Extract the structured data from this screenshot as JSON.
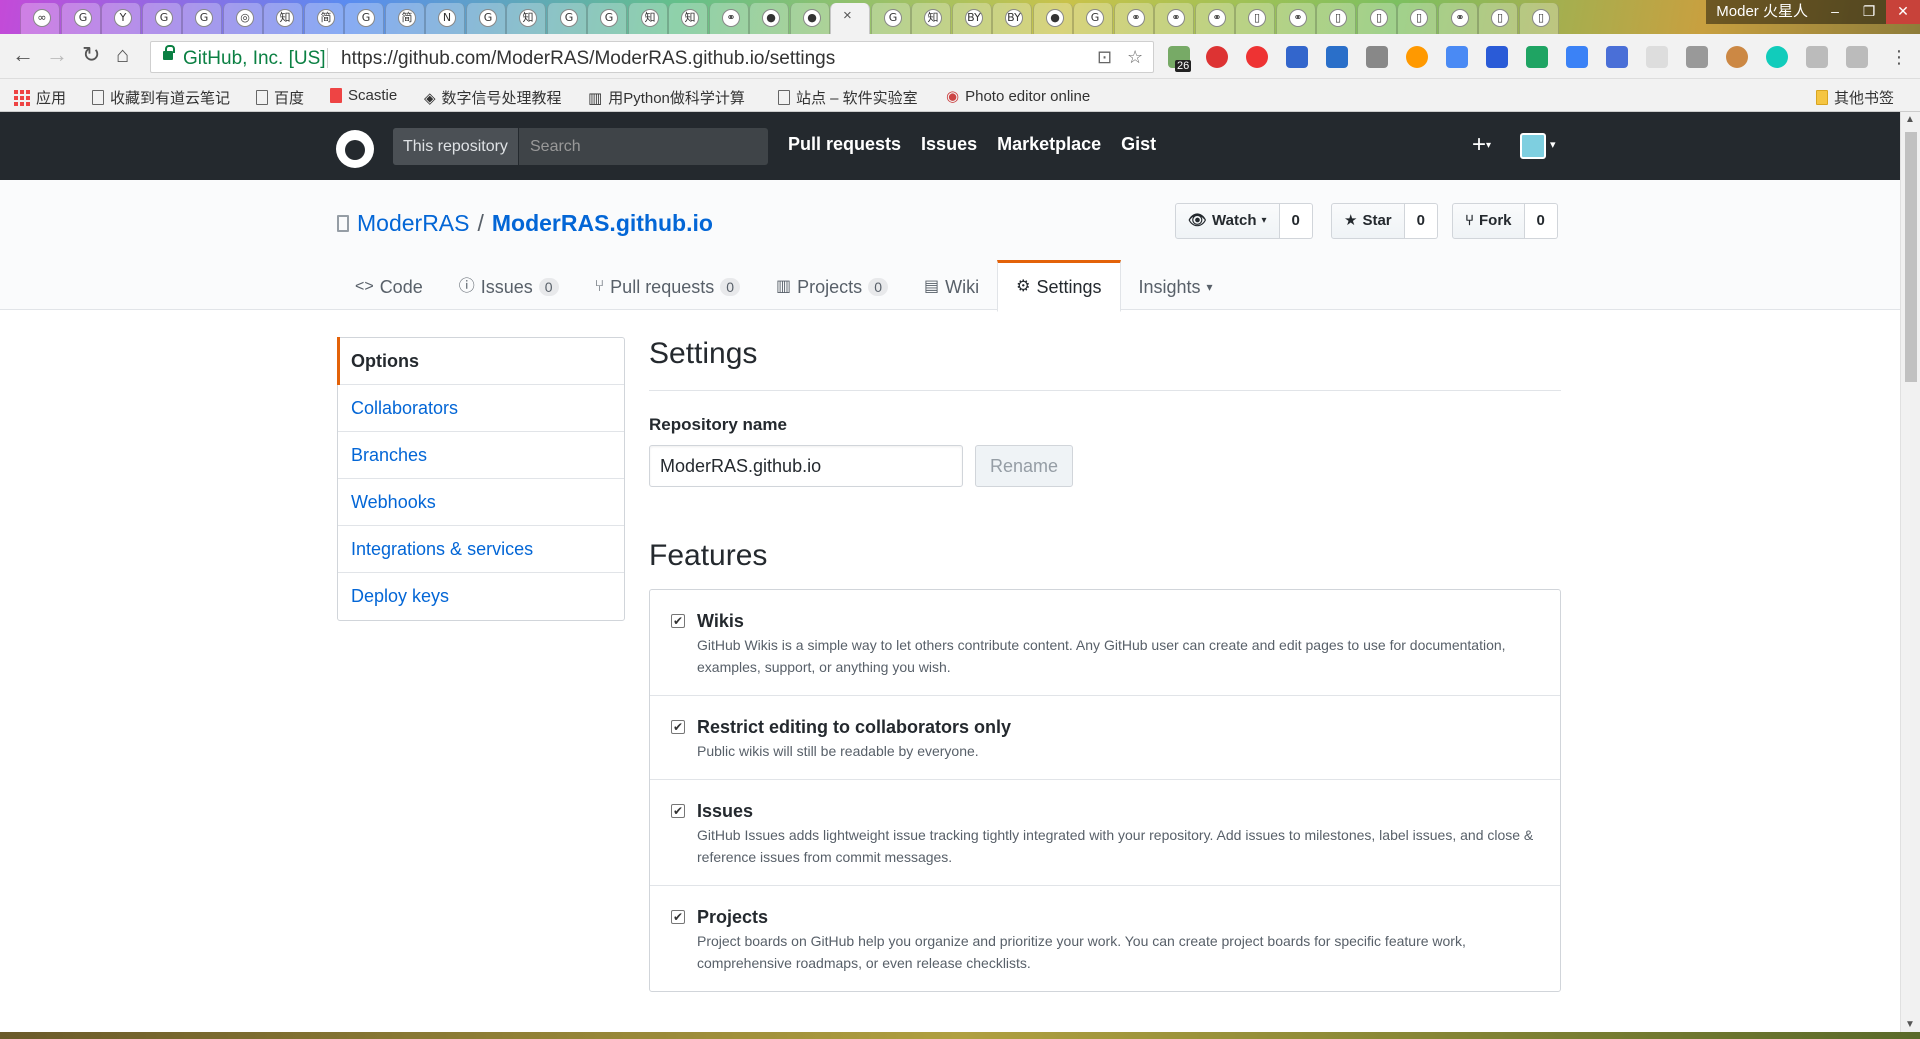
{
  "browser": {
    "window_profile": "Moder",
    "profile_name": "火星人",
    "active_tab_close": "×",
    "tabs": [
      {
        "icon": "infinity-icon",
        "glyph": "∞"
      },
      {
        "icon": "google-icon",
        "glyph": "G"
      },
      {
        "icon": "filter-icon",
        "glyph": "Y"
      },
      {
        "icon": "google-icon",
        "glyph": "G"
      },
      {
        "icon": "google-icon",
        "glyph": "G"
      },
      {
        "icon": "circle-icon",
        "glyph": "◎"
      },
      {
        "icon": "zhihu-icon",
        "glyph": "知"
      },
      {
        "icon": "jianshu-icon",
        "glyph": "简"
      },
      {
        "icon": "google-icon",
        "glyph": "G"
      },
      {
        "icon": "jianshu-icon",
        "glyph": "简"
      },
      {
        "icon": "n-icon",
        "glyph": "N"
      },
      {
        "icon": "google-icon",
        "glyph": "G"
      },
      {
        "icon": "zhihu-icon",
        "glyph": "知"
      },
      {
        "icon": "google-icon",
        "glyph": "G"
      },
      {
        "icon": "google-icon",
        "glyph": "G"
      },
      {
        "icon": "zhihu-icon",
        "glyph": "知"
      },
      {
        "icon": "zhihu-icon",
        "glyph": "知"
      },
      {
        "icon": "link-icon",
        "glyph": "⚭"
      },
      {
        "icon": "github-icon",
        "glyph": "●"
      },
      {
        "icon": "github-icon",
        "glyph": "●"
      },
      {
        "icon": "active",
        "glyph": ""
      },
      {
        "icon": "google-icon",
        "glyph": "G"
      },
      {
        "icon": "zhihu-icon",
        "glyph": "知"
      },
      {
        "icon": "by-icon",
        "glyph": "BY"
      },
      {
        "icon": "by-icon",
        "glyph": "BY"
      },
      {
        "icon": "github-icon",
        "glyph": "●"
      },
      {
        "icon": "google-icon",
        "glyph": "G"
      },
      {
        "icon": "link-icon",
        "glyph": "⚭"
      },
      {
        "icon": "link-icon",
        "glyph": "⚭"
      },
      {
        "icon": "link-icon",
        "glyph": "⚭"
      },
      {
        "icon": "page-icon",
        "glyph": "▯"
      },
      {
        "icon": "link-icon",
        "glyph": "⚭"
      },
      {
        "icon": "page-icon",
        "glyph": "▯"
      },
      {
        "icon": "page-icon",
        "glyph": "▯"
      },
      {
        "icon": "page-icon",
        "glyph": "▯"
      },
      {
        "icon": "link-icon",
        "glyph": "⚭"
      },
      {
        "icon": "page-icon",
        "glyph": "▯"
      },
      {
        "icon": "page-icon",
        "glyph": "▯"
      }
    ],
    "security_label": "GitHub, Inc. [US]",
    "url": "https://github.com/ModerRAS/ModerRAS.github.io/settings",
    "ext_badge": "26",
    "bookmarks": [
      {
        "label": "应用",
        "icon": "apps-icon"
      },
      {
        "label": "收藏到有道云笔记",
        "icon": "page-icon"
      },
      {
        "label": "百度",
        "icon": "page-icon"
      },
      {
        "label": "Scastie",
        "icon": "scastie-icon"
      },
      {
        "label": "数字信号处理教程",
        "icon": "diamond-icon"
      },
      {
        "label": "用Python做科学计算",
        "icon": "book-icon"
      },
      {
        "label": "站点 – 软件实验室",
        "icon": "page-icon"
      },
      {
        "label": "Photo editor online",
        "icon": "photo-icon"
      }
    ],
    "other_bookmarks": "其他书签"
  },
  "header": {
    "search_scope": "This repository",
    "search_placeholder": "Search",
    "nav": [
      "Pull requests",
      "Issues",
      "Marketplace",
      "Gist"
    ],
    "plus": "+"
  },
  "repo": {
    "owner": "ModerRAS",
    "separator": "/",
    "name": "ModerRAS.github.io",
    "watch_label": "Watch",
    "watch_count": "0",
    "star_label": "Star",
    "star_count": "0",
    "fork_label": "Fork",
    "fork_count": "0",
    "tabs": [
      {
        "label": "Code",
        "icon": "code-icon",
        "glyph": "<>",
        "counter": null
      },
      {
        "label": "Issues",
        "icon": "issue-icon",
        "glyph": "ⓘ",
        "counter": "0"
      },
      {
        "label": "Pull requests",
        "icon": "pull-request-icon",
        "glyph": "⑂",
        "counter": "0"
      },
      {
        "label": "Projects",
        "icon": "project-icon",
        "glyph": "▥",
        "counter": "0"
      },
      {
        "label": "Wiki",
        "icon": "book-icon",
        "glyph": "▤",
        "counter": null
      },
      {
        "label": "Settings",
        "icon": "gear-icon",
        "glyph": "⚙",
        "counter": null,
        "selected": true
      },
      {
        "label": "Insights",
        "icon": "caret-down-icon",
        "glyph": "▾",
        "counter": null,
        "dropdown": true
      }
    ]
  },
  "sidebar": {
    "items": [
      "Options",
      "Collaborators",
      "Branches",
      "Webhooks",
      "Integrations & services",
      "Deploy keys"
    ]
  },
  "settings": {
    "title": "Settings",
    "repo_name_label": "Repository name",
    "repo_name_value": "ModerRAS.github.io",
    "rename_label": "Rename",
    "features_title": "Features",
    "features": [
      {
        "title": "Wikis",
        "checked": true,
        "desc": "GitHub Wikis is a simple way to let others contribute content. Any GitHub user can create and edit pages to use for documentation, examples, support, or anything you wish."
      },
      {
        "title": "Restrict editing to collaborators only",
        "checked": true,
        "desc": "Public wikis will still be readable by everyone."
      },
      {
        "title": "Issues",
        "checked": true,
        "desc": "GitHub Issues adds lightweight issue tracking tightly integrated with your repository. Add issues to milestones, label issues, and close & reference issues from commit messages."
      },
      {
        "title": "Projects",
        "checked": true,
        "desc": "Project boards on GitHub help you organize and prioritize your work. You can create project boards for specific feature work, comprehensive roadmaps, or even release checklists."
      }
    ]
  },
  "colors": {
    "header_bg": "#24292e",
    "link": "#0366d6",
    "accent": "#e36209",
    "secure_green": "#0b8043"
  }
}
